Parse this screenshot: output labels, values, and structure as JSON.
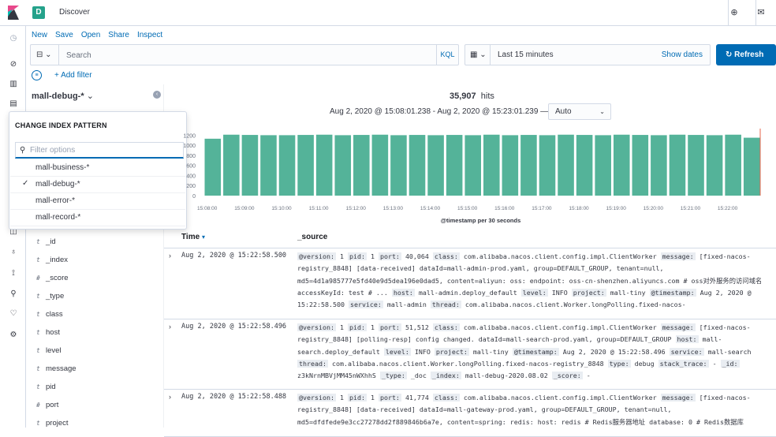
{
  "app": {
    "space_letter": "D",
    "title": "Discover"
  },
  "menu": [
    "New",
    "Save",
    "Open",
    "Share",
    "Inspect"
  ],
  "query": {
    "placeholder": "Search",
    "language": "KQL"
  },
  "time": {
    "range_label": "Last 15 minutes",
    "show_dates": "Show dates",
    "refresh": "Refresh"
  },
  "filter": {
    "add_label": "+ Add filter"
  },
  "sidebar": {
    "index_pattern": "mall-debug-*",
    "fields": [
      {
        "type": "t",
        "name": "_id"
      },
      {
        "type": "t",
        "name": "_index"
      },
      {
        "type": "#",
        "name": "_score"
      },
      {
        "type": "t",
        "name": "_type"
      },
      {
        "type": "t",
        "name": "class"
      },
      {
        "type": "t",
        "name": "host"
      },
      {
        "type": "t",
        "name": "level"
      },
      {
        "type": "t",
        "name": "message"
      },
      {
        "type": "t",
        "name": "pid"
      },
      {
        "type": "#",
        "name": "port"
      },
      {
        "type": "t",
        "name": "project"
      }
    ]
  },
  "popover": {
    "title": "CHANGE INDEX PATTERN",
    "search_placeholder": "Filter options",
    "options": [
      {
        "label": "mall-business-*",
        "selected": false
      },
      {
        "label": "mall-debug-*",
        "selected": true
      },
      {
        "label": "mall-error-*",
        "selected": false
      },
      {
        "label": "mall-record-*",
        "selected": false
      }
    ]
  },
  "results": {
    "hits_count": "35,907",
    "hits_label": "hits",
    "range_text": "Aug 2, 2020 @ 15:08:01.238 - Aug 2, 2020 @ 15:23:01.239 —",
    "interval": "Auto"
  },
  "chart_data": {
    "type": "bar",
    "categories": [
      "15:08:00",
      "15:08:30",
      "15:09:00",
      "15:09:30",
      "15:10:00",
      "15:10:30",
      "15:11:00",
      "15:11:30",
      "15:12:00",
      "15:12:30",
      "15:13:00",
      "15:13:30",
      "15:14:00",
      "15:14:30",
      "15:15:00",
      "15:15:30",
      "15:16:00",
      "15:16:30",
      "15:17:00",
      "15:17:30",
      "15:18:00",
      "15:18:30",
      "15:19:00",
      "15:19:30",
      "15:20:00",
      "15:20:30",
      "15:21:00",
      "15:21:30",
      "15:22:00",
      "15:22:30"
    ],
    "values": [
      1130,
      1210,
      1205,
      1200,
      1200,
      1205,
      1210,
      1200,
      1205,
      1210,
      1200,
      1205,
      1200,
      1205,
      1200,
      1210,
      1200,
      1205,
      1200,
      1210,
      1205,
      1200,
      1210,
      1205,
      1200,
      1210,
      1205,
      1200,
      1210,
      1150
    ],
    "x_tick_labels": [
      "15:08:00",
      "15:09:00",
      "15:10:00",
      "15:11:00",
      "15:12:00",
      "15:13:00",
      "15:14:00",
      "15:15:00",
      "15:16:00",
      "15:17:00",
      "15:18:00",
      "15:19:00",
      "15:20:00",
      "15:21:00",
      "15:22:00"
    ],
    "y_tick_labels": [
      "0",
      "200",
      "400",
      "600",
      "800",
      "1000",
      "1200"
    ],
    "ylim": [
      0,
      1300
    ],
    "xlabel": "@timestamp per 30 seconds",
    "ylabel": "",
    "bar_color": "#54b399",
    "marker_color": "#e7664c"
  },
  "table": {
    "time_header": "Time",
    "source_header": "_source",
    "rows": [
      {
        "time": "Aug 2, 2020 @ 15:22:58.500",
        "source": [
          [
            "@version:",
            "1"
          ],
          [
            "pid:",
            "1"
          ],
          [
            "port:",
            "40,064"
          ],
          [
            "class:",
            "com.alibaba.nacos.client.config.impl.ClientWorker"
          ],
          [
            "message:",
            "[fixed-nacos-registry_8848] [data-received] dataId=mall-admin-prod.yaml, group=DEFAULT_GROUP, tenant=null, md5=4d1a985777e5fd40e9d5dea196e0dad5, content=aliyun: oss: endpoint: oss-cn-shenzhen.aliyuncs.com # oss对外服务的访问域名 accessKeyId: test # ..."
          ],
          [
            "host:",
            "mall-admin.deploy_default"
          ],
          [
            "level:",
            "INFO"
          ],
          [
            "project:",
            "mall-tiny"
          ],
          [
            "@timestamp:",
            "Aug 2, 2020 @ 15:22:58.500"
          ],
          [
            "service:",
            "mall-admin"
          ],
          [
            "thread:",
            "com.alibaba.nacos.client.Worker.longPolling.fixed-nacos-"
          ]
        ]
      },
      {
        "time": "Aug 2, 2020 @ 15:22:58.496",
        "source": [
          [
            "@version:",
            "1"
          ],
          [
            "pid:",
            "1"
          ],
          [
            "port:",
            "51,512"
          ],
          [
            "class:",
            "com.alibaba.nacos.client.config.impl.ClientWorker"
          ],
          [
            "message:",
            "[fixed-nacos-registry_8848] [polling-resp] config changed. dataId=mall-search-prod.yaml, group=DEFAULT_GROUP"
          ],
          [
            "host:",
            "mall-search.deploy_default"
          ],
          [
            "level:",
            "INFO"
          ],
          [
            "project:",
            "mall-tiny"
          ],
          [
            "@timestamp:",
            "Aug 2, 2020 @ 15:22:58.496"
          ],
          [
            "service:",
            "mall-search"
          ],
          [
            "thread:",
            "com.alibaba.nacos.client.Worker.longPolling.fixed-nacos-registry_8848"
          ],
          [
            "type:",
            "debug"
          ],
          [
            "stack_trace:",
            "-"
          ],
          [
            "_id:",
            "z3kNrnMBVjMM45nWXhhS"
          ],
          [
            "_type:",
            "_doc"
          ],
          [
            "_index:",
            "mall-debug-2020.08.02"
          ],
          [
            "_score:",
            "-"
          ]
        ]
      },
      {
        "time": "Aug 2, 2020 @ 15:22:58.488",
        "source": [
          [
            "@version:",
            "1"
          ],
          [
            "pid:",
            "1"
          ],
          [
            "port:",
            "41,774"
          ],
          [
            "class:",
            "com.alibaba.nacos.client.config.impl.ClientWorker"
          ],
          [
            "message:",
            "[fixed-nacos-registry_8848] [data-received] dataId=mall-gateway-prod.yaml, group=DEFAULT_GROUP, tenant=null, md5=dfdfede9e3cc27278dd2f889846b6a7e, content=spring: redis: host: redis # Redis服务器地址 database: 0 # Redis数据库"
          ]
        ]
      }
    ]
  }
}
